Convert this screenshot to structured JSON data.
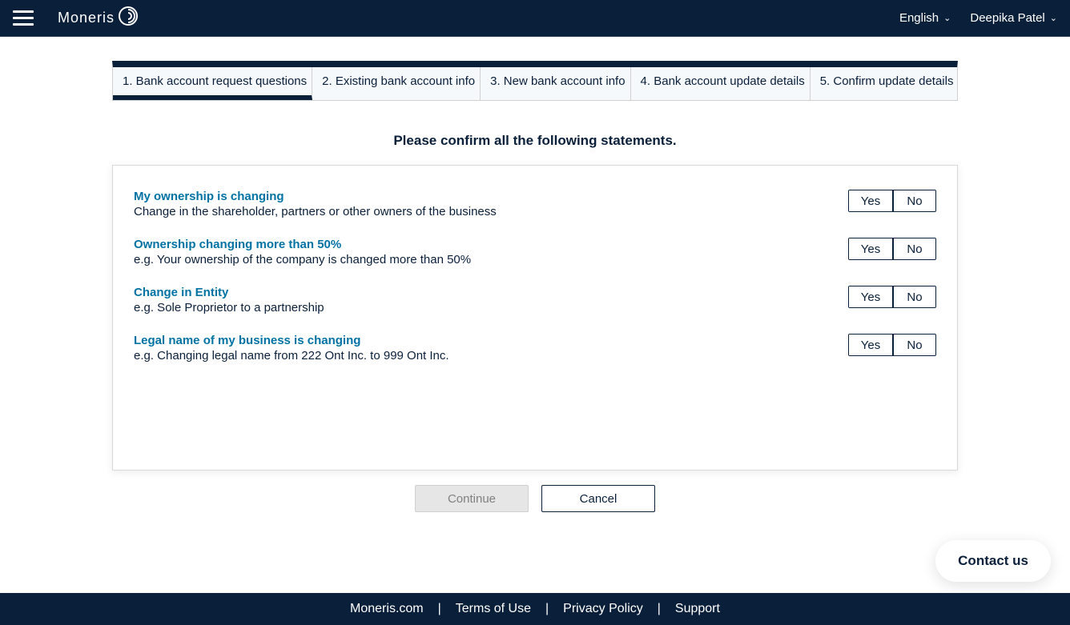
{
  "header": {
    "brand": "Moneris",
    "language": "English",
    "user": "Deepika Patel"
  },
  "stepper": {
    "steps": [
      "1. Bank account request questions",
      "2. Existing bank account info",
      "3. New bank account info",
      "4. Bank account update details",
      "5. Confirm update details"
    ]
  },
  "instruction": "Please confirm all the following statements.",
  "questions": [
    {
      "title": "My ownership is changing",
      "desc": "Change in the shareholder, partners or other owners of the business"
    },
    {
      "title": "Ownership changing more than 50%",
      "desc": "e.g. Your ownership of the company is changed more than 50%"
    },
    {
      "title": "Change in Entity",
      "desc": "e.g. Sole Proprietor to a partnership"
    },
    {
      "title": "Legal name of my business is changing",
      "desc": "e.g. Changing legal name from 222 Ont Inc. to 999 Ont Inc."
    }
  ],
  "labels": {
    "yes": "Yes",
    "no": "No",
    "continue": "Continue",
    "cancel": "Cancel",
    "contact": "Contact us"
  },
  "footer": {
    "links": [
      "Moneris.com",
      "Terms of Use",
      "Privacy Policy",
      "Support"
    ]
  }
}
